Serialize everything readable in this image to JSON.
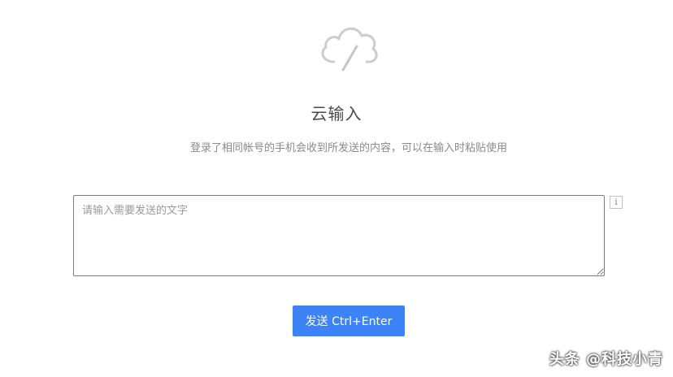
{
  "header": {
    "icon": "cloud-pen-icon",
    "title": "云输入",
    "subtitle": "登录了相同帐号的手机会收到所发送的内容，可以在输入时粘贴使用"
  },
  "input": {
    "placeholder": "请输入需要发送的文字",
    "value": ""
  },
  "info_button": {
    "icon": "info-icon",
    "label": "i"
  },
  "send_button": {
    "label": "发送 Ctrl+Enter"
  },
  "watermark": {
    "text": "头条 @科技小青"
  },
  "colors": {
    "accent": "#3c83f6",
    "text_title": "#4a4a4a",
    "text_muted": "#8a8a8a",
    "icon_gray": "#cccccc"
  }
}
